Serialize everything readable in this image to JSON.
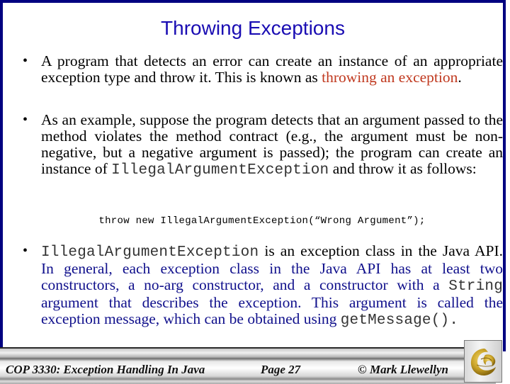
{
  "slide": {
    "title": "Throwing Exceptions",
    "bullets": [
      {
        "parts": [
          {
            "text": "A program that detects an error can create an instance of an appropriate exception type and throw it.  This is known as ",
            "style": "normal"
          },
          {
            "text": "throwing an exception",
            "style": "red"
          },
          {
            "text": ".",
            "style": "normal"
          }
        ]
      },
      {
        "parts": [
          {
            "text": "As an example, suppose the program detects that an argument passed to the method violates the method contract (e.g., the argument must be non-negative, but a negative argument is passed); the program can create an instance of ",
            "style": "normal"
          },
          {
            "text": "IllegalArgumentException",
            "style": "mono"
          },
          {
            "text": " and throw it as follows:",
            "style": "normal"
          }
        ]
      },
      {
        "parts": [
          {
            "text": "IllegalArgumentException",
            "style": "mono"
          },
          {
            "text": " is an exception class in the Java API.  ",
            "style": "normal"
          },
          {
            "text": "In general, each exception class in the Java API has at least two constructors, a no-arg constructor, and a constructor with a ",
            "style": "blue"
          },
          {
            "text": "String",
            "style": "mono"
          },
          {
            "text": " argument that describes the exception.   This argument is called the exception message, which can be obtained using ",
            "style": "blue"
          },
          {
            "text": "getMessage().",
            "style": "mono"
          }
        ]
      }
    ],
    "bullet_glyph": "•",
    "code_example": "throw new IllegalArgumentException(“Wrong Argument”);"
  },
  "footer": {
    "course": "COP 3330:  Exception Handling In Java",
    "page": "Page 27",
    "author": "© Mark Llewellyn",
    "logo_icon": "ucf-pegasus-logo"
  },
  "colors": {
    "frame": "#000080",
    "title": "#1a0db3",
    "highlight_red": "#c0391f",
    "highlight_blue": "#10108c",
    "logo_gold": "#c9a227"
  }
}
